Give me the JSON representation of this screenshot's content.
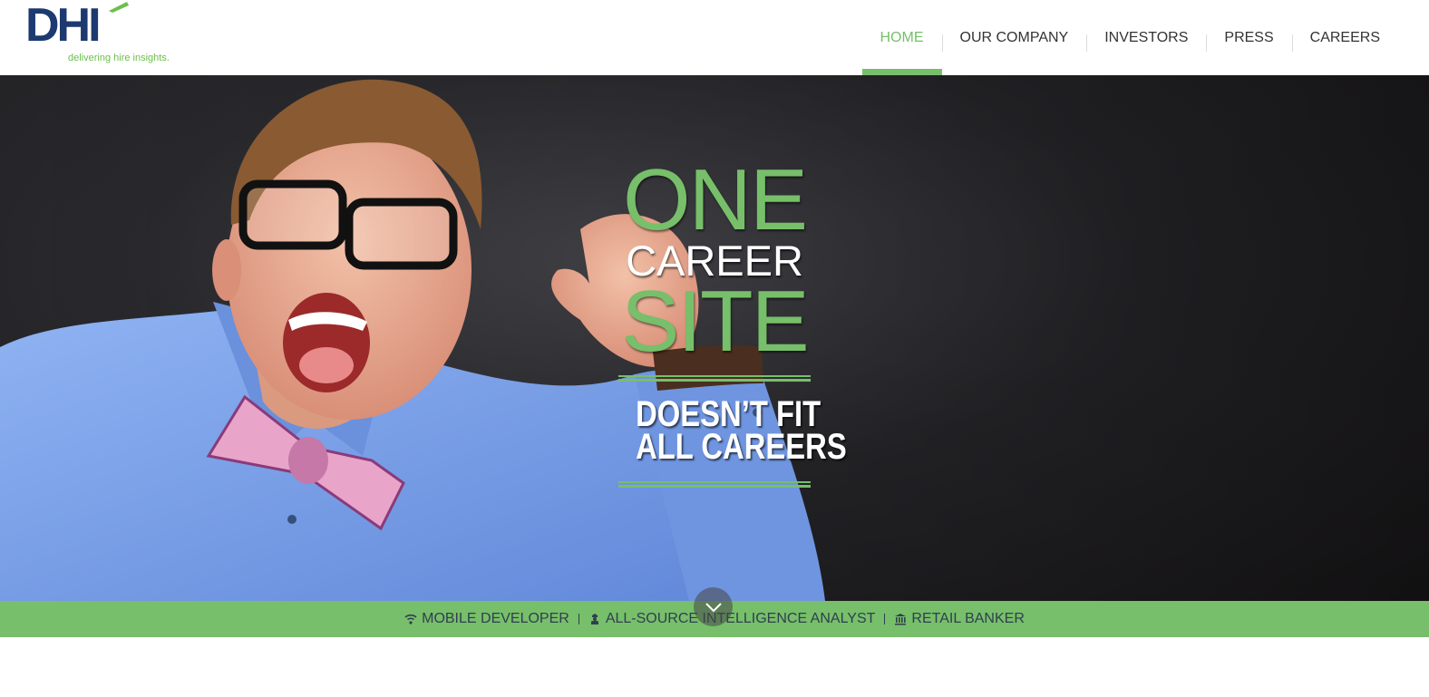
{
  "brand": {
    "logo_text": "DHI",
    "tagline": "delivering hire insights.",
    "accent_color": "#77bf6a",
    "navy_color": "#1c3a70"
  },
  "nav": {
    "items": [
      {
        "label": "HOME",
        "active": true
      },
      {
        "label": "OUR COMPANY",
        "active": false
      },
      {
        "label": "INVESTORS",
        "active": false
      },
      {
        "label": "PRESS",
        "active": false
      },
      {
        "label": "CAREERS",
        "active": false
      }
    ]
  },
  "hero": {
    "line1": "ONE",
    "line2": "CAREER",
    "line3": "SITE",
    "line4": "DOESN’T FIT",
    "line5": "ALL CAREERS"
  },
  "ticker": {
    "items": [
      {
        "label": "MOBILE DEVELOPER",
        "icon": "wifi-icon"
      },
      {
        "label": "ALL-SOURCE INTELLIGENCE ANALYST",
        "icon": "security-officer-icon"
      },
      {
        "label": "RETAIL BANKER",
        "icon": "bank-icon"
      }
    ],
    "scroll_icon": "chevron-down-icon"
  }
}
